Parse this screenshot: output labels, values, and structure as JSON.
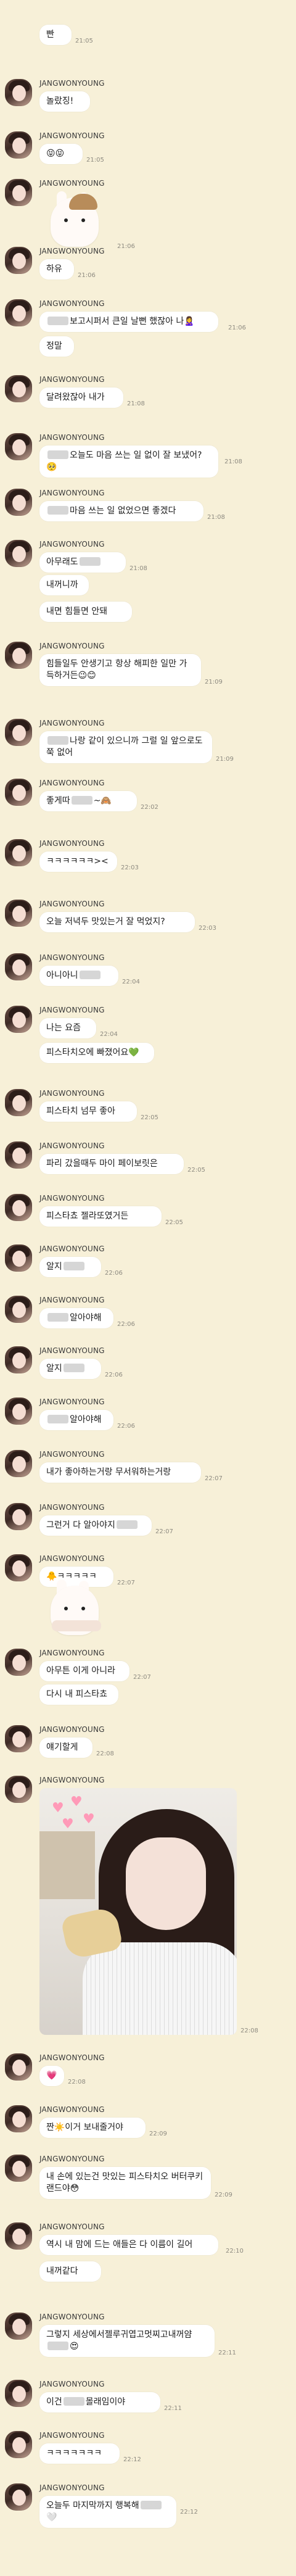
{
  "sender": "JANGWONYOUNG",
  "messages": [
    {
      "type": "text",
      "parts": [
        "빤"
      ],
      "time": "21:05"
    },
    {
      "type": "text",
      "parts": [
        "놀랐징!"
      ],
      "time": ""
    },
    {
      "type": "text",
      "parts": [
        "😝😝"
      ],
      "time": "21:05"
    },
    {
      "type": "sticker",
      "sticker": "bunny-hat-sticker",
      "time": "21:06"
    },
    {
      "type": "text",
      "parts": [
        "하유"
      ],
      "time": "21:06"
    },
    {
      "type": "text",
      "parts": [
        "{blur}",
        "보고시퍼서 큰일 날뻔 했잖아 나🙎‍♀️"
      ],
      "time": "21:06"
    },
    {
      "type": "text",
      "parts": [
        "정말"
      ],
      "time": ""
    },
    {
      "type": "text",
      "parts": [
        "달려왔잖아 내가"
      ],
      "time": "21:08"
    },
    {
      "type": "text",
      "parts": [
        "{blur}",
        "오늘도 마음 쓰는 일 없이 잘 보냈어?🥺"
      ],
      "time": "21:08"
    },
    {
      "type": "text",
      "parts": [
        "{blur}",
        "마음 쓰는 일 없었으면 좋겠다"
      ],
      "time": "21:08"
    },
    {
      "type": "text",
      "parts": [
        "아무래도",
        "{blur}"
      ],
      "time": "21:08"
    },
    {
      "type": "text",
      "parts": [
        "내꺼니까"
      ],
      "time": ""
    },
    {
      "type": "text",
      "parts": [
        "내면 힘들면 안돼"
      ],
      "time": ""
    },
    {
      "type": "text",
      "parts": [
        "힘들일두 안생기고 항상 해피한 일만 가득하거든😉😊"
      ],
      "time": "21:09"
    },
    {
      "type": "text",
      "parts": [
        "{blur}",
        "나랑 같이 있으니까 그럴 일 앞으로도 쭉 없어"
      ],
      "time": "21:09"
    },
    {
      "type": "text",
      "parts": [
        "좋게따",
        "{blur}",
        "~🙈"
      ],
      "time": "22:02"
    },
    {
      "type": "text",
      "parts": [
        "ㅋㅋㅋㅋㅋㅋ><"
      ],
      "time": "22:03"
    },
    {
      "type": "text",
      "parts": [
        "오늘 저녁두 맛있는거 잘 먹었지?"
      ],
      "time": "22:03"
    },
    {
      "type": "text",
      "parts": [
        "아니아니",
        "{blur}"
      ],
      "time": "22:04"
    },
    {
      "type": "text",
      "parts": [
        "나는 요즘"
      ],
      "time": "22:04"
    },
    {
      "type": "text",
      "parts": [
        "피스타치오에 빠졌어요💚"
      ],
      "time": ""
    },
    {
      "type": "text",
      "parts": [
        "피스타치 넘무 좋아"
      ],
      "time": "22:05"
    },
    {
      "type": "text",
      "parts": [
        "파리 갔을때두 마이 페이보릿은"
      ],
      "time": "22:05"
    },
    {
      "type": "text",
      "parts": [
        "피스타쵸 젤라또였거든"
      ],
      "time": "22:05"
    },
    {
      "type": "text",
      "parts": [
        "알지",
        "{blur}"
      ],
      "time": "22:06"
    },
    {
      "type": "text",
      "parts": [
        "{blur}",
        "알아야해"
      ],
      "time": "22:06"
    },
    {
      "type": "text",
      "parts": [
        "알지",
        "{blur}"
      ],
      "time": "22:06"
    },
    {
      "type": "text",
      "parts": [
        "{blur}",
        "알아야해"
      ],
      "time": "22:06"
    },
    {
      "type": "text",
      "parts": [
        "내가 좋아하는거랑 무서워하는거랑"
      ],
      "time": "22:07"
    },
    {
      "type": "text",
      "parts": [
        "그런거 다 알아야지",
        "{blur}"
      ],
      "time": "22:07"
    },
    {
      "type": "text",
      "parts": [
        "🐥ㅋㅋㅋㅋㅋ"
      ],
      "time": "22:07"
    },
    {
      "type": "sticker",
      "sticker": "bunny-paw-sticker",
      "time": ""
    },
    {
      "type": "text",
      "parts": [
        "아무튼 이게 아니라"
      ],
      "time": "22:07"
    },
    {
      "type": "text",
      "parts": [
        "다시 내 피스타쵸"
      ],
      "time": ""
    },
    {
      "type": "text",
      "parts": [
        "얘기할게"
      ],
      "time": "22:08"
    },
    {
      "type": "photo",
      "time": "22:08"
    },
    {
      "type": "text",
      "parts": [
        "💗"
      ],
      "time": "22:08"
    },
    {
      "type": "text",
      "parts": [
        "짠☀️이거 보내줄거야"
      ],
      "time": "22:09"
    },
    {
      "type": "text",
      "parts": [
        "내 손에 있는건 맛있는 피스타치오 버터쿠키랜드야😳"
      ],
      "time": "22:09"
    },
    {
      "type": "text",
      "parts": [
        "역시 내 맘에 드는 애들은 다 이름이 길어"
      ],
      "time": "22:10"
    },
    {
      "type": "text",
      "parts": [
        "내꺼같다"
      ],
      "time": ""
    },
    {
      "type": "text",
      "parts": [
        "그렇지 세상에서젤루귀엽고멋찌고내꺼얌",
        "{blur}",
        "😍"
      ],
      "time": "22:11"
    },
    {
      "type": "text",
      "parts": [
        "이건",
        "{blur}",
        "몰래임이야"
      ],
      "time": "22:11"
    },
    {
      "type": "text",
      "parts": [
        "ㅋㅋㅋㅋㅋㅋㅋ"
      ],
      "time": "22:12"
    },
    {
      "type": "text",
      "parts": [
        "오늘두 마지막까지 행복해",
        "{blur}",
        "🤍"
      ],
      "time": "22:12"
    }
  ]
}
